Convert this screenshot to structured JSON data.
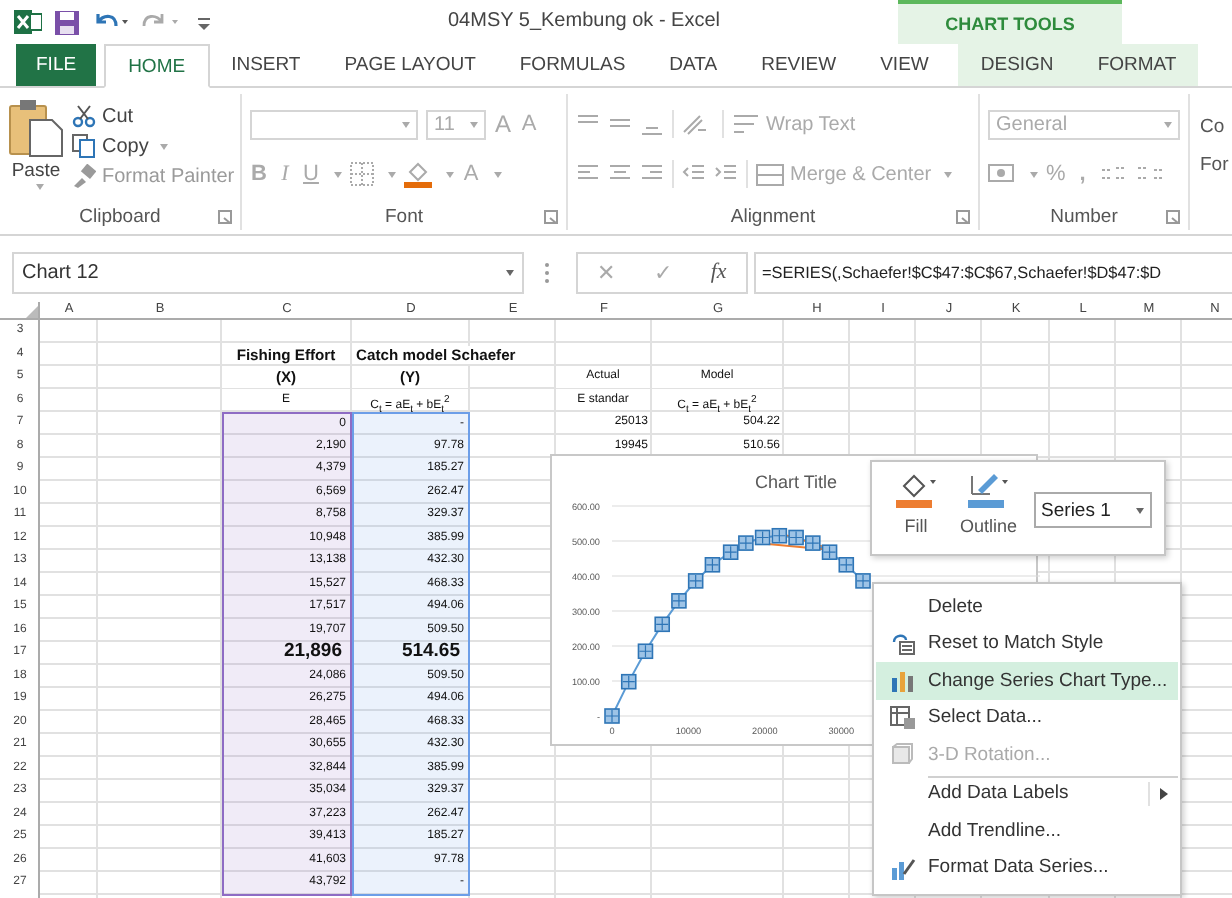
{
  "title_bar": {
    "title": "04MSY 5_Kembung ok - Excel",
    "contextual_header": "CHART TOOLS"
  },
  "tabs": [
    {
      "label": "FILE",
      "selected": false,
      "kind": "file"
    },
    {
      "label": "HOME",
      "selected": true,
      "kind": "plain"
    },
    {
      "label": "INSERT",
      "selected": false,
      "kind": "plain"
    },
    {
      "label": "PAGE LAYOUT",
      "selected": false,
      "kind": "plain"
    },
    {
      "label": "FORMULAS",
      "selected": false,
      "kind": "plain"
    },
    {
      "label": "DATA",
      "selected": false,
      "kind": "plain"
    },
    {
      "label": "REVIEW",
      "selected": false,
      "kind": "plain"
    },
    {
      "label": "VIEW",
      "selected": false,
      "kind": "plain"
    },
    {
      "label": "DESIGN",
      "selected": false,
      "kind": "contextual"
    },
    {
      "label": "FORMAT",
      "selected": false,
      "kind": "contextual"
    }
  ],
  "ribbon": {
    "clipboard": {
      "label": "Clipboard",
      "paste": "Paste",
      "cut": "Cut",
      "copy": "Copy",
      "format_painter": "Format Painter",
      "format_painter_disabled": true
    },
    "font": {
      "label": "Font",
      "size": "11",
      "grow": "A",
      "shrink": "A",
      "bold": "B",
      "italic": "I",
      "underline": "U",
      "font_color": "A",
      "disabled": true
    },
    "alignment": {
      "label": "Alignment",
      "wrap_text": "Wrap Text",
      "merge": "Merge & Center",
      "disabled": true
    },
    "number": {
      "label": "Number",
      "format": "General",
      "percent": "%",
      "comma": ",",
      "disabled": true
    },
    "cut_off_button": [
      "Co",
      "For"
    ]
  },
  "formula_bar": {
    "name_box": "Chart 12",
    "cancel": "✕",
    "enter": "✓",
    "function": "fx",
    "formula": "=SERIES(,Schaefer!$C$47:$C$67,Schaefer!$D$47:$D"
  },
  "sheet": {
    "columns": [
      "A",
      "B",
      "C",
      "D",
      "E",
      "F",
      "G",
      "H",
      "I",
      "J",
      "K",
      "L",
      "M",
      "N"
    ],
    "rows": [
      {
        "number": "3",
        "cells": {}
      },
      {
        "number": "4",
        "kind": "header",
        "cells": {
          "C": {
            "text": "Fishing Effort",
            "bold": true
          },
          "D": {
            "text": "Catch model Schaefer",
            "bold": true
          }
        }
      },
      {
        "number": "5",
        "kind": "header",
        "cells": {
          "C": {
            "text": "(X)",
            "bold": true
          },
          "D": {
            "text": "(Y)",
            "bold": true
          },
          "F": {
            "text": "Actual",
            "bold": false
          },
          "G": {
            "text": "Model",
            "bold": false
          }
        }
      },
      {
        "number": "6",
        "kind": "header",
        "cells": {
          "C": {
            "text": "E",
            "bold": false
          },
          "D": {
            "text": "C$_{t}$ = aE$_{t}$ + bE$_{t}$$^{2}$",
            "bold": false
          },
          "F": {
            "text": "E standar",
            "bold": false
          },
          "G": {
            "text": "C$_{t}$ = aE$_{t}$ + bE$_{t}$$^{2}$",
            "bold": false
          }
        }
      },
      {
        "number": "7",
        "kind": "data",
        "cells": {
          "C": {
            "text": "0",
            "bold": false,
            "color": "#8e6cc4"
          },
          "D": {
            "text": "-",
            "bold": false,
            "color": "#6c9ee8"
          },
          "F": {
            "text": "25013",
            "bold": false
          },
          "G": {
            "text": "504.22",
            "bold": false
          }
        }
      },
      {
        "number": "8",
        "kind": "data",
        "cells": {
          "C": {
            "text": "2,190",
            "bold": false,
            "color": "#8e6cc4"
          },
          "D": {
            "text": "97.78",
            "bold": false,
            "color": "#6c9ee8"
          },
          "F": {
            "text": "19945",
            "bold": false
          },
          "G": {
            "text": "510.56",
            "bold": false
          }
        }
      },
      {
        "number": "9",
        "kind": "data",
        "cells": {
          "C": {
            "text": "4,379",
            "bold": false,
            "color": "#8e6cc4"
          },
          "D": {
            "text": "185.27",
            "bold": false,
            "color": "#6c9ee8"
          }
        }
      },
      {
        "number": "10",
        "kind": "data",
        "cells": {
          "C": {
            "text": "6,569",
            "bold": false,
            "color": "#8e6cc4"
          },
          "D": {
            "text": "262.47",
            "bold": false,
            "color": "#6c9ee8"
          }
        }
      },
      {
        "number": "11",
        "kind": "data",
        "cells": {
          "C": {
            "text": "8,758",
            "bold": false,
            "color": "#8e6cc4"
          },
          "D": {
            "text": "329.37",
            "bold": false,
            "color": "#6c9ee8"
          }
        }
      },
      {
        "number": "12",
        "kind": "data",
        "cells": {
          "C": {
            "text": "10,948",
            "bold": false,
            "color": "#8e6cc4"
          },
          "D": {
            "text": "385.99",
            "bold": false,
            "color": "#6c9ee8"
          }
        }
      },
      {
        "number": "13",
        "kind": "data",
        "cells": {
          "C": {
            "text": "13,138",
            "bold": false,
            "color": "#8e6cc4"
          },
          "D": {
            "text": "432.30",
            "bold": false,
            "color": "#6c9ee8"
          }
        }
      },
      {
        "number": "14",
        "kind": "data",
        "cells": {
          "C": {
            "text": "15,527",
            "bold": false,
            "color": "#8e6cc4"
          },
          "D": {
            "text": "468.33",
            "bold": false,
            "color": "#6c9ee8"
          }
        }
      },
      {
        "number": "15",
        "kind": "data",
        "cells": {
          "C": {
            "text": "17,517",
            "bold": false,
            "color": "#8e6cc4"
          },
          "D": {
            "text": "494.06",
            "bold": false,
            "color": "#6c9ee8"
          }
        }
      },
      {
        "number": "16",
        "kind": "data",
        "cells": {
          "C": {
            "text": "19,707",
            "bold": false,
            "color": "#8e6cc4"
          },
          "D": {
            "text": "509.50",
            "bold": false,
            "color": "#6c9ee8"
          }
        }
      },
      {
        "number": "17",
        "kind": "emphasis",
        "cells": {
          "C": {
            "text": "21,896",
            "bold": true,
            "color": "#8e6cc4"
          },
          "D": {
            "text": "514.65",
            "bold": true,
            "color": "#6c9ee8"
          }
        }
      },
      {
        "number": "18",
        "kind": "data",
        "cells": {
          "C": {
            "text": "24,086",
            "bold": false,
            "color": "#8e6cc4"
          },
          "D": {
            "text": "509.50",
            "bold": false,
            "color": "#6c9ee8"
          }
        }
      },
      {
        "number": "19",
        "kind": "data",
        "cells": {
          "C": {
            "text": "26,275",
            "bold": false,
            "color": "#8e6cc4"
          },
          "D": {
            "text": "494.06",
            "bold": false,
            "color": "#6c9ee8"
          }
        }
      },
      {
        "number": "20",
        "kind": "data",
        "cells": {
          "C": {
            "text": "28,465",
            "bold": false,
            "color": "#8e6cc4"
          },
          "D": {
            "text": "468.33",
            "bold": false,
            "color": "#6c9ee8"
          }
        }
      },
      {
        "number": "21",
        "kind": "data",
        "cells": {
          "C": {
            "text": "30,655",
            "bold": false,
            "color": "#8e6cc4"
          },
          "D": {
            "text": "432.30",
            "bold": false,
            "color": "#6c9ee8"
          }
        }
      },
      {
        "number": "22",
        "kind": "data",
        "cells": {
          "C": {
            "text": "32,844",
            "bold": false,
            "color": "#8e6cc4"
          },
          "D": {
            "text": "385.99",
            "bold": false,
            "color": "#6c9ee8"
          }
        }
      },
      {
        "number": "23",
        "kind": "data",
        "cells": {
          "C": {
            "text": "35,034",
            "bold": false,
            "color": "#8e6cc4"
          },
          "D": {
            "text": "329.37",
            "bold": false,
            "color": "#6c9ee8"
          }
        }
      },
      {
        "number": "24",
        "kind": "data",
        "cells": {
          "C": {
            "text": "37,223",
            "bold": false,
            "color": "#8e6cc4"
          },
          "D": {
            "text": "262.47",
            "bold": false,
            "color": "#6c9ee8"
          }
        }
      },
      {
        "number": "25",
        "kind": "data",
        "cells": {
          "C": {
            "text": "39,413",
            "bold": false,
            "color": "#8e6cc4"
          },
          "D": {
            "text": "185.27",
            "bold": false,
            "color": "#6c9ee8"
          }
        }
      },
      {
        "number": "26",
        "kind": "data",
        "cells": {
          "C": {
            "text": "41,603",
            "bold": false,
            "color": "#8e6cc4"
          },
          "D": {
            "text": "97.78",
            "bold": false,
            "color": "#6c9ee8"
          }
        }
      },
      {
        "number": "27",
        "kind": "data",
        "cells": {
          "C": {
            "text": "43,792",
            "bold": false,
            "color": "#8e6cc4"
          },
          "D": {
            "text": "-",
            "bold": false,
            "color": "#6c9ee8"
          }
        }
      }
    ]
  },
  "chart": {
    "chart_data": {
      "type": "line",
      "title": "Chart Title",
      "grid": true,
      "x": [
        0,
        2190,
        4379,
        6569,
        8758,
        10948,
        13138,
        15527,
        17517,
        19707,
        21896,
        24086,
        26275,
        28465,
        30655,
        32844
      ],
      "series": [
        {
          "color": "#5b9bd5",
          "marker": "square",
          "values": [
            0,
            98,
            185,
            262,
            329,
            386,
            432,
            468,
            494,
            510,
            515,
            510,
            494,
            468,
            432,
            386
          ]
        }
      ],
      "xlim": [
        0,
        56000
      ],
      "ylim": [
        0,
        600
      ],
      "yticks": [
        {
          "value": 0,
          "label": "-"
        },
        {
          "value": 100,
          "label": "100.00"
        },
        {
          "value": 200,
          "label": "200.00"
        },
        {
          "value": 300,
          "label": "300.00"
        },
        {
          "value": 400,
          "label": "400.00"
        },
        {
          "value": 500,
          "label": "500.00"
        },
        {
          "value": 600,
          "label": "600.00"
        }
      ],
      "xticks": [
        0,
        10000,
        20000,
        30000
      ]
    }
  },
  "mini_toolbar": {
    "fill": "Fill",
    "outline": "Outline",
    "series": "Series 1"
  },
  "context_menu": [
    {
      "label": "Delete",
      "kind": "plain",
      "selected": false,
      "disabled": false,
      "separator_before": false
    },
    {
      "label": "Reset to Match Style",
      "kind": "reset",
      "selected": false,
      "disabled": false,
      "separator_before": false
    },
    {
      "label": "Change Series Chart Type...",
      "kind": "charttype",
      "selected": true,
      "disabled": false,
      "separator_before": false
    },
    {
      "label": "Select Data...",
      "kind": "data",
      "selected": false,
      "disabled": false,
      "separator_before": false
    },
    {
      "label": "3-D Rotation...",
      "kind": "rotation",
      "selected": false,
      "disabled": true,
      "separator_before": false
    },
    {
      "label": "Add Data Labels",
      "kind": "submenu",
      "selected": false,
      "disabled": false,
      "separator_before": true
    },
    {
      "label": "Add Trendline...",
      "kind": "plain",
      "selected": false,
      "disabled": false,
      "separator_before": false
    },
    {
      "label": "Format Data Series...",
      "kind": "format",
      "selected": false,
      "disabled": false,
      "separator_before": false
    }
  ]
}
